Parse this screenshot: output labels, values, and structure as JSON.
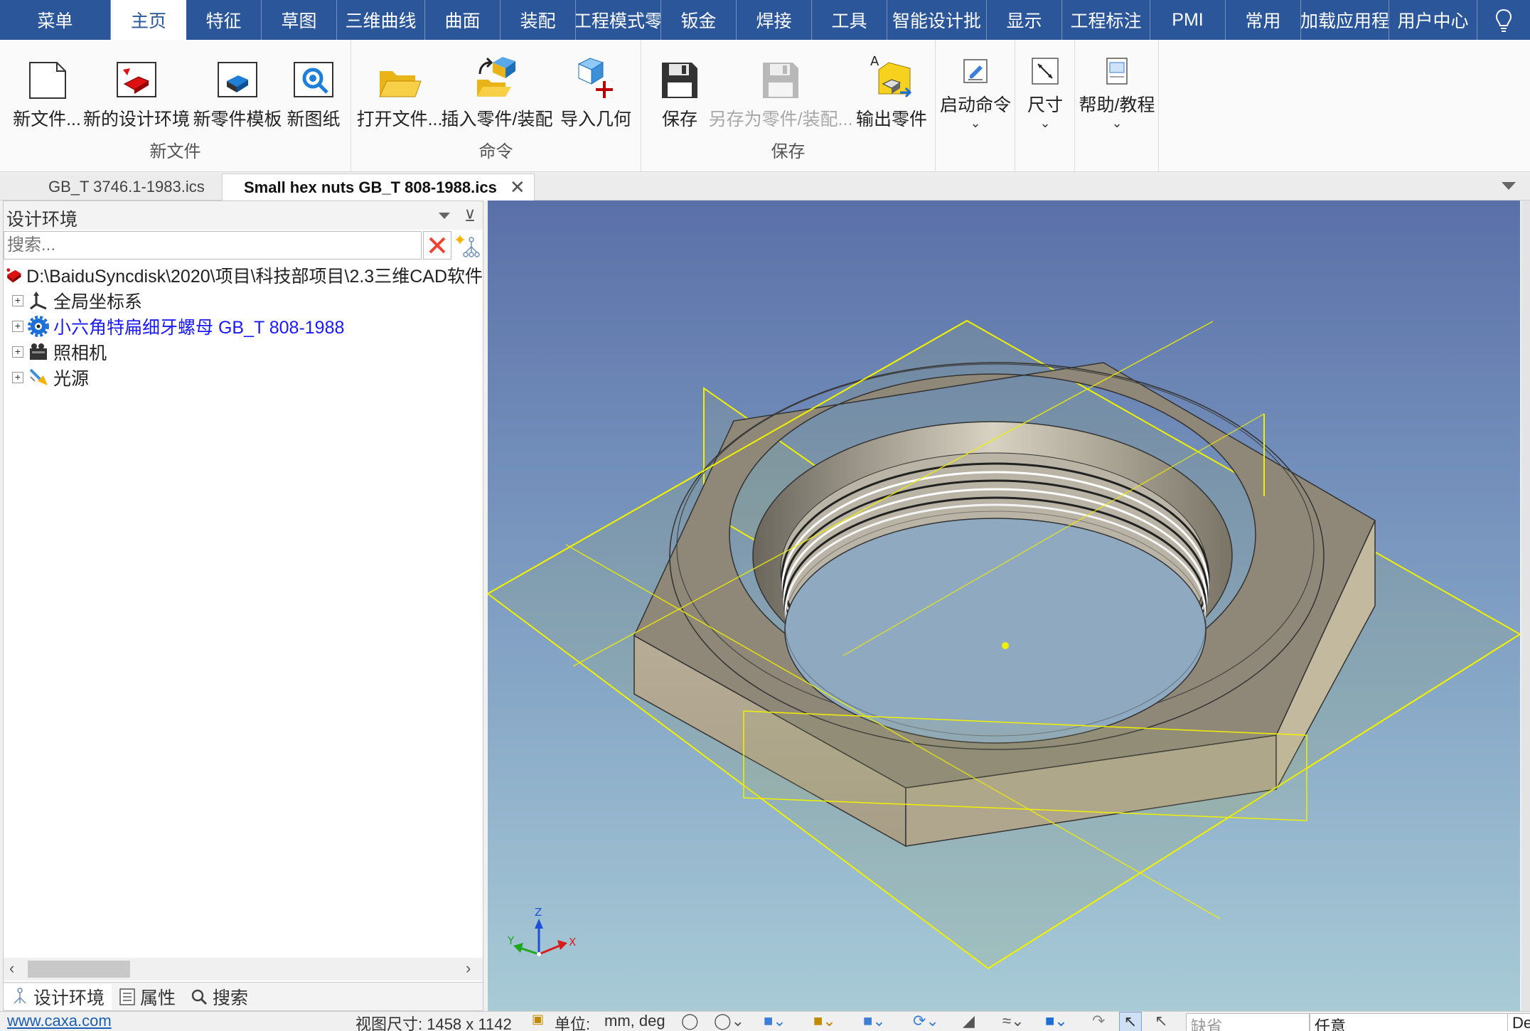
{
  "menu_tabs": [
    {
      "label": "菜单"
    },
    {
      "label": "主页",
      "active": true
    },
    {
      "label": "特征"
    },
    {
      "label": "草图"
    },
    {
      "label": "三维曲线"
    },
    {
      "label": "曲面"
    },
    {
      "label": "装配"
    },
    {
      "label": "工程模式零"
    },
    {
      "label": "钣金"
    },
    {
      "label": "焊接"
    },
    {
      "label": "工具"
    },
    {
      "label": "智能设计批"
    },
    {
      "label": "显示"
    },
    {
      "label": "工程标注"
    },
    {
      "label": "PMI"
    },
    {
      "label": "常用"
    },
    {
      "label": "加载应用程"
    },
    {
      "label": "用户中心"
    }
  ],
  "ribbon": {
    "group_new": {
      "label": "新文件",
      "new_file": "新文件...",
      "new_env": "新的设计环境",
      "new_part_template": "新零件模板",
      "new_drawing": "新图纸"
    },
    "group_cmd": {
      "label": "命令",
      "open_file": "打开文件...",
      "insert_part": "插入零件/装配",
      "import_geometry": "导入几何"
    },
    "group_save": {
      "label": "保存",
      "save": "保存",
      "save_as": "另存为零件/装配...",
      "export_part": "输出零件"
    },
    "launch_cmd": "启动命令",
    "dimension": "尺寸",
    "help": "帮助/教程"
  },
  "doc_tabs": [
    {
      "label": "GB_T 3746.1-1983.ics"
    },
    {
      "label": "Small hex nuts GB_T 808-1988.ics",
      "active": true
    }
  ],
  "panel": {
    "title": "设计环境",
    "search_placeholder": "搜索...",
    "tree_root": "D:\\BaiduSyncdisk\\2020\\项目\\科技部项目\\2.3三维CAD软件",
    "tree_items": [
      {
        "label": "全局坐标系",
        "icon": "coordinate-system-icon"
      },
      {
        "label": "小六角特扁细牙螺母 GB_T 808-1988",
        "icon": "part-gear-icon"
      },
      {
        "label": "照相机",
        "icon": "camera-icon"
      },
      {
        "label": "光源",
        "icon": "light-source-icon"
      }
    ],
    "bottom_tabs": [
      {
        "label": "设计环境",
        "active": true
      },
      {
        "label": "属性"
      },
      {
        "label": "搜索"
      }
    ]
  },
  "viewport": {
    "axes": {
      "x": "X",
      "y": "Y",
      "z": "Z"
    }
  },
  "status": {
    "website": "www.caxa.com",
    "view_size": "视图尺寸: 1458 x 1142",
    "units_label": "单位:",
    "units_value": "mm, deg",
    "filter_value": "缺省",
    "select_value": "任意",
    "last_box": "Def"
  },
  "colors": {
    "menubar": "#2b579a",
    "active_link": "#1a1aff",
    "nut_top": "#8f8778",
    "nut_side": "#b0a68d",
    "datum_plane": "#f0f000"
  }
}
